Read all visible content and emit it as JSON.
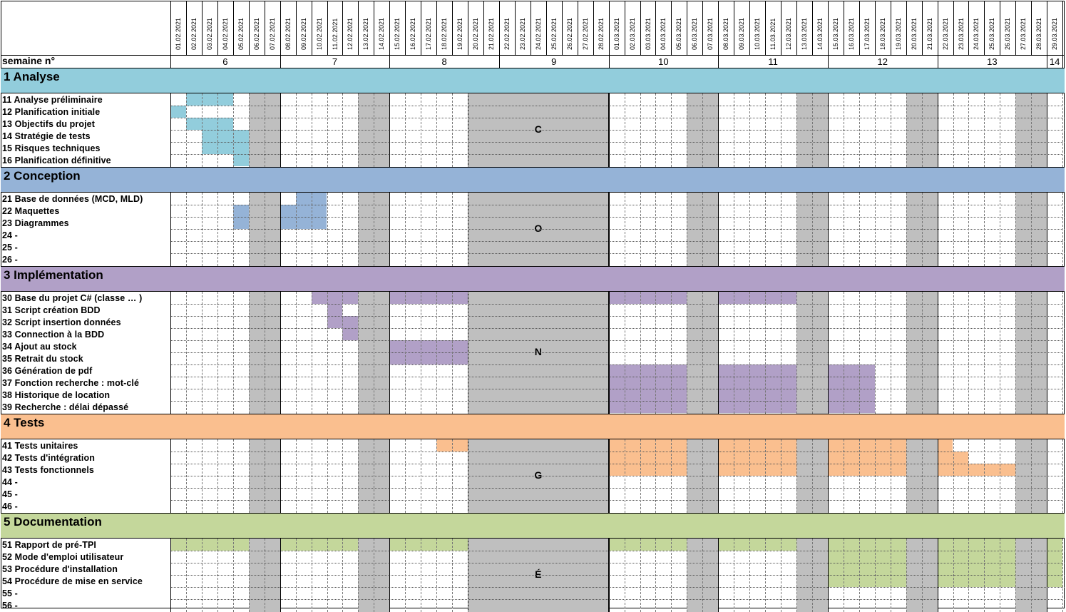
{
  "header": {
    "week_label": "semaine n°",
    "dates": [
      "01.02.2021",
      "02.02.2021",
      "03.02.2021",
      "04.02.2021",
      "05.02.2021",
      "06.02.2021",
      "07.02.2021",
      "08.02.2021",
      "09.02.2021",
      "10.02.2021",
      "11.02.2021",
      "12.02.2021",
      "13.02.2021",
      "14.02.2021",
      "15.02.2021",
      "16.02.2021",
      "17.02.2021",
      "18.02.2021",
      "19.02.2021",
      "20.02.2021",
      "21.02.2021",
      "22.02.2021",
      "23.02.2021",
      "24.02.2021",
      "25.02.2021",
      "26.02.2021",
      "27.02.2021",
      "28.02.2021",
      "01.03.2021",
      "02.03.2021",
      "03.03.2021",
      "04.03.2021",
      "05.03.2021",
      "06.03.2021",
      "07.03.2021",
      "08.03.2021",
      "09.03.2021",
      "10.03.2021",
      "11.03.2021",
      "12.03.2021",
      "13.03.2021",
      "14.03.2021",
      "15.03.2021",
      "16.03.2021",
      "17.03.2021",
      "18.03.2021",
      "19.03.2021",
      "20.03.2021",
      "21.03.2021",
      "22.03.2021",
      "23.03.2021",
      "24.03.2021",
      "25.03.2021",
      "26.03.2021",
      "27.03.2021",
      "28.03.2021",
      "29.03.2021"
    ],
    "weeks": [
      "6",
      "7",
      "8",
      "9",
      "10",
      "11",
      "12",
      "13",
      "14"
    ]
  },
  "colors": {
    "analyse": "#92cddc",
    "conception": "#95b3d7",
    "implementation": "#b1a0c7",
    "tests": "#fabf8f",
    "documentation": "#c4d79b",
    "weekend": "#bfbfbf"
  },
  "vacation_letters": [
    "C",
    "O",
    "N",
    "G",
    "É"
  ],
  "sections": [
    {
      "title": "1 Analyse",
      "color_key": "analyse",
      "tasks": [
        {
          "label": "11 Analyse préliminaire",
          "bars": [
            [
              1,
              4
            ]
          ]
        },
        {
          "label": "12 Planification initiale",
          "bars": [
            [
              0,
              1
            ]
          ]
        },
        {
          "label": "13 Objectifs du projet",
          "bars": [
            [
              1,
              4
            ]
          ]
        },
        {
          "label": "14 Stratégie de tests",
          "bars": [
            [
              2,
              5
            ]
          ]
        },
        {
          "label": "15 Risques techniques",
          "bars": [
            [
              2,
              5
            ]
          ]
        },
        {
          "label": "16 Planification définitive",
          "bars": [
            [
              4,
              5
            ]
          ]
        }
      ]
    },
    {
      "title": "2 Conception",
      "color_key": "conception",
      "tasks": [
        {
          "label": "21 Base de données (MCD, MLD)",
          "bars": [
            [
              8,
              10
            ]
          ]
        },
        {
          "label": "22 Maquettes",
          "bars": [
            [
              4,
              5
            ],
            [
              7,
              10
            ]
          ]
        },
        {
          "label": "23 Diagrammes",
          "bars": [
            [
              4,
              5
            ],
            [
              7,
              10
            ]
          ]
        },
        {
          "label": "24 -",
          "bars": []
        },
        {
          "label": "25 -",
          "bars": []
        },
        {
          "label": "26 -",
          "bars": []
        }
      ]
    },
    {
      "title": "3 Implémentation",
      "color_key": "implementation",
      "tasks": [
        {
          "label": "30 Base du projet C# (classe … )",
          "bars": [
            [
              9,
              12
            ],
            [
              14,
              19
            ],
            [
              28,
              33
            ],
            [
              35,
              40
            ]
          ]
        },
        {
          "label": "31 Script création BDD",
          "bars": [
            [
              10,
              11
            ]
          ]
        },
        {
          "label": "32 Script insertion données",
          "bars": [
            [
              10,
              12
            ]
          ]
        },
        {
          "label": "33  Connection à la BDD",
          "bars": [
            [
              11,
              12
            ]
          ]
        },
        {
          "label": "34  Ajout au stock",
          "bars": [
            [
              14,
              19
            ]
          ]
        },
        {
          "label": "35  Retrait du stock",
          "bars": [
            [
              14,
              19
            ]
          ]
        },
        {
          "label": "36 Génération de pdf",
          "bars": [
            [
              28,
              33
            ],
            [
              35,
              40
            ],
            [
              42,
              45
            ]
          ]
        },
        {
          "label": "37 Fonction recherche : mot-clé",
          "bars": [
            [
              28,
              33
            ],
            [
              35,
              40
            ],
            [
              42,
              45
            ]
          ]
        },
        {
          "label": "38 Historique de location",
          "bars": [
            [
              28,
              33
            ],
            [
              35,
              40
            ],
            [
              42,
              45
            ]
          ]
        },
        {
          "label": "39 Recherche : délai dépassé",
          "bars": [
            [
              28,
              33
            ],
            [
              35,
              40
            ],
            [
              42,
              45
            ]
          ]
        }
      ]
    },
    {
      "title": "4 Tests",
      "color_key": "tests",
      "tasks": [
        {
          "label": "41 Tests unitaires",
          "bars": [
            [
              17,
              19
            ],
            [
              28,
              33
            ],
            [
              35,
              40
            ],
            [
              42,
              47
            ],
            [
              49,
              50
            ]
          ]
        },
        {
          "label": "42 Tests d'intégration",
          "bars": [
            [
              28,
              33
            ],
            [
              35,
              40
            ],
            [
              42,
              47
            ],
            [
              49,
              51
            ]
          ]
        },
        {
          "label": "43 Tests fonctionnels",
          "bars": [
            [
              28,
              33
            ],
            [
              35,
              40
            ],
            [
              42,
              47
            ],
            [
              49,
              54
            ]
          ]
        },
        {
          "label": "44 -",
          "bars": []
        },
        {
          "label": "45 -",
          "bars": []
        },
        {
          "label": "46 -",
          "bars": []
        }
      ]
    },
    {
      "title": "5 Documentation",
      "color_key": "documentation",
      "tasks": [
        {
          "label": "51 Rapport de pré-TPI",
          "bars": [
            [
              0,
              5
            ],
            [
              7,
              12
            ],
            [
              14,
              19
            ],
            [
              28,
              33
            ],
            [
              35,
              40
            ],
            [
              42,
              47
            ],
            [
              49,
              54
            ],
            [
              56,
              57
            ]
          ]
        },
        {
          "label": "52 Mode d'emploi utilisateur",
          "bars": [
            [
              42,
              47
            ],
            [
              49,
              54
            ],
            [
              56,
              57
            ]
          ]
        },
        {
          "label": "53 Procédure d'installation",
          "bars": [
            [
              42,
              47
            ],
            [
              49,
              54
            ],
            [
              56,
              57
            ]
          ]
        },
        {
          "label": "54 Procédure de mise en service",
          "bars": [
            [
              42,
              47
            ],
            [
              49,
              54
            ],
            [
              56,
              57
            ]
          ]
        },
        {
          "label": "55 -",
          "bars": []
        },
        {
          "label": "56 -",
          "bars": []
        }
      ]
    }
  ]
}
